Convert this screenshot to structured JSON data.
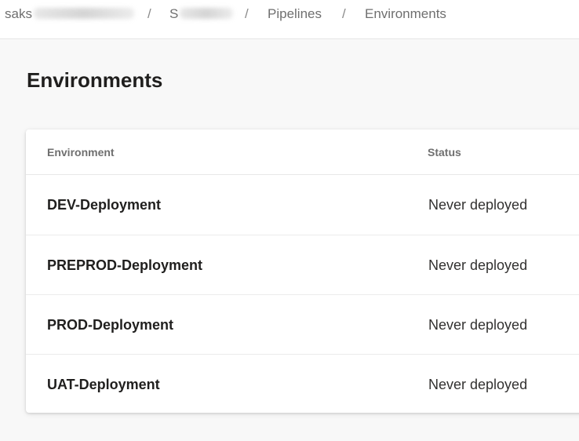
{
  "breadcrumb": {
    "organization": "saks",
    "project": "S",
    "pipelines": "Pipelines",
    "environments": "Environments",
    "separator": "/"
  },
  "page": {
    "title": "Environments"
  },
  "table": {
    "columns": {
      "environment": "Environment",
      "status": "Status"
    },
    "rows": [
      {
        "name": "DEV-Deployment",
        "status": "Never deployed"
      },
      {
        "name": "PREPROD-Deployment",
        "status": "Never deployed"
      },
      {
        "name": "PROD-Deployment",
        "status": "Never deployed"
      },
      {
        "name": "UAT-Deployment",
        "status": "Never deployed"
      }
    ]
  },
  "colors": {
    "background": "#f8f8f8",
    "card": "#ffffff",
    "text": "#201f1e",
    "muted": "#6f6f6f"
  }
}
